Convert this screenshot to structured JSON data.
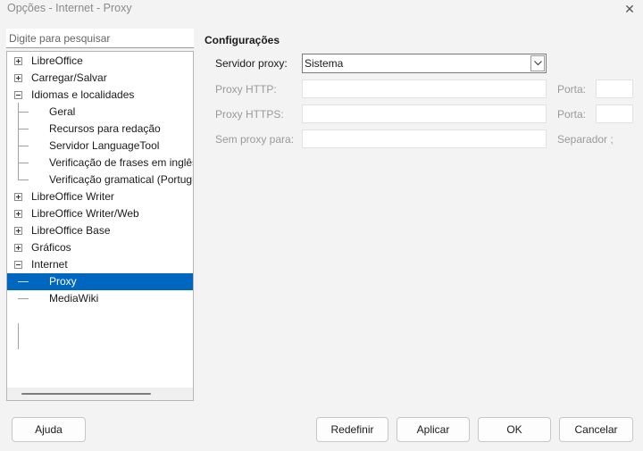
{
  "window": {
    "title": "Opções - Internet - Proxy"
  },
  "search": {
    "placeholder": "Digite para pesquisar"
  },
  "tree": {
    "items": [
      {
        "label": "LibreOffice",
        "level": 0,
        "expanded": false
      },
      {
        "label": "Carregar/Salvar",
        "level": 0,
        "expanded": false
      },
      {
        "label": "Idiomas e localidades",
        "level": 0,
        "expanded": true
      },
      {
        "label": "Geral",
        "level": 1
      },
      {
        "label": "Recursos para redação",
        "level": 1
      },
      {
        "label": "Servidor LanguageTool",
        "level": 1
      },
      {
        "label": "Verificação de frases em inglês",
        "level": 1
      },
      {
        "label": "Verificação gramatical (Português)",
        "level": 1
      },
      {
        "label": "LibreOffice Writer",
        "level": 0,
        "expanded": false
      },
      {
        "label": "LibreOffice Writer/Web",
        "level": 0,
        "expanded": false
      },
      {
        "label": "LibreOffice Base",
        "level": 0,
        "expanded": false
      },
      {
        "label": "Gráficos",
        "level": 0,
        "expanded": false
      },
      {
        "label": "Internet",
        "level": 0,
        "expanded": true
      },
      {
        "label": "Proxy",
        "level": 1,
        "selected": true
      },
      {
        "label": "MediaWiki",
        "level": 1
      }
    ]
  },
  "settings": {
    "section_title": "Configurações",
    "proxy_server_label": "Servidor proxy:",
    "proxy_server_value": "Sistema",
    "http_label": "Proxy HTTP:",
    "https_label": "Proxy HTTPS:",
    "noproxy_label": "Sem proxy para:",
    "port_label": "Porta:",
    "separator_label": "Separador ;"
  },
  "buttons": {
    "help": "Ajuda",
    "reset": "Redefinir",
    "apply": "Aplicar",
    "ok": "OK",
    "cancel": "Cancelar"
  },
  "colors": {
    "selection": "#0067c0",
    "background": "#f3f3f3"
  }
}
